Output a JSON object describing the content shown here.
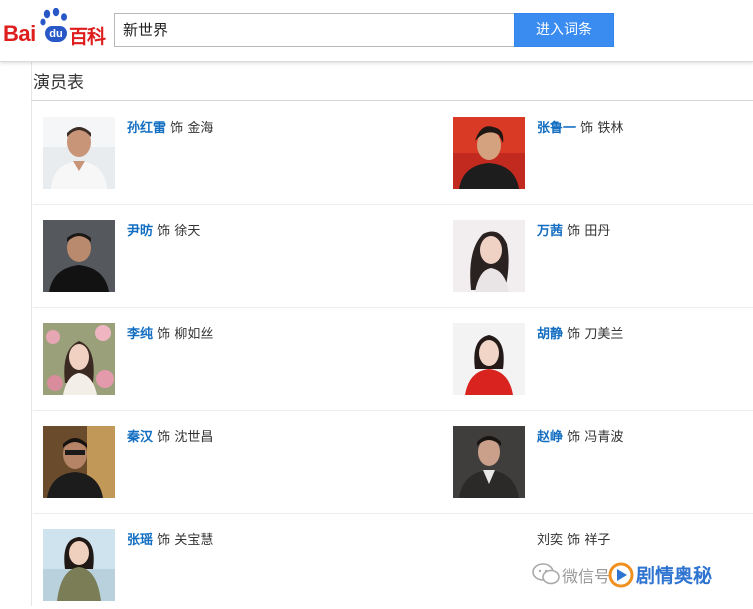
{
  "header": {
    "logo_bai": "Bai",
    "logo_du": "du",
    "logo_baike": "百科",
    "search_value": "新世界",
    "enter_button": "进入词条"
  },
  "section": {
    "title": "演员表"
  },
  "cast": [
    {
      "actor": "孙红雷",
      "role_word": "饰",
      "role": "金海"
    },
    {
      "actor": "张鲁一",
      "role_word": "饰",
      "role": "铁林"
    },
    {
      "actor": "尹昉",
      "role_word": "饰",
      "role": "徐天"
    },
    {
      "actor": "万茜",
      "role_word": "饰",
      "role": "田丹"
    },
    {
      "actor": "李纯",
      "role_word": "饰",
      "role": "柳如丝"
    },
    {
      "actor": "胡静",
      "role_word": "饰",
      "role": "刀美兰"
    },
    {
      "actor": "秦汉",
      "role_word": "饰",
      "role": "沈世昌"
    },
    {
      "actor": "赵峥",
      "role_word": "饰",
      "role": "冯青波"
    },
    {
      "actor": "张瑶",
      "role_word": "饰",
      "role": "关宝慧"
    },
    {
      "actor": "刘奕",
      "role_word": "饰",
      "role": "祥子"
    }
  ],
  "watermark": {
    "prefix": "微信号",
    "name": "剧情奥秘"
  },
  "colors": {
    "brand_red": "#de1d1d",
    "brand_blue": "#2858c8",
    "button_blue": "#3b8cf0",
    "link_blue": "#136ec2"
  }
}
